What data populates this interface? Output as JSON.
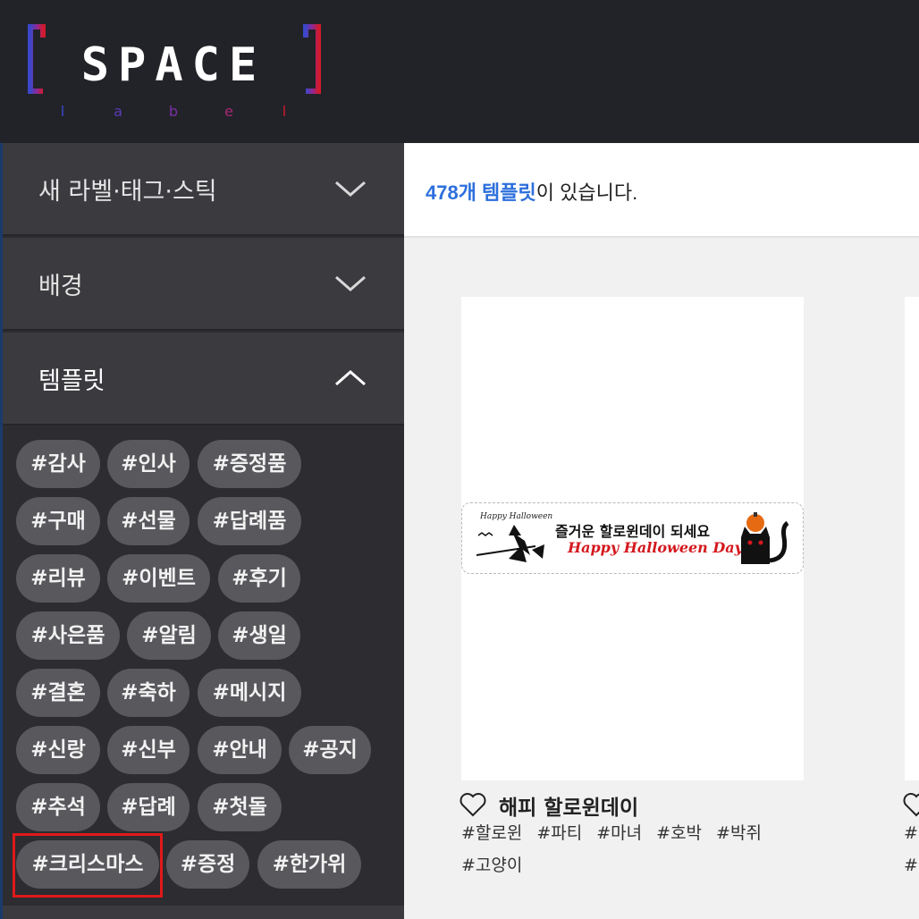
{
  "logo": {
    "main": "SPACE",
    "sub": [
      "l",
      "a",
      "b",
      "e",
      "l"
    ]
  },
  "sidebar": {
    "sections": [
      {
        "label": "새 라벨·태그·스틱",
        "state": "collapsed"
      },
      {
        "label": "배경",
        "state": "collapsed"
      },
      {
        "label": "템플릿",
        "state": "expanded"
      }
    ],
    "tags": [
      "#감사",
      "#인사",
      "#증정품",
      "#구매",
      "#선물",
      "#답례품",
      "#리뷰",
      "#이벤트",
      "#후기",
      "#사은품",
      "#알림",
      "#생일",
      "#결혼",
      "#축하",
      "#메시지",
      "#신랑",
      "#신부",
      "#안내",
      "#공지",
      "#추석",
      "#답례",
      "#첫돌",
      "#크리스마스",
      "#증정",
      "#한가위"
    ],
    "selected_tag": "#크리스마스"
  },
  "content": {
    "count_number": "478개 템플릿",
    "count_suffix": "이 있습니다."
  },
  "cards": [
    {
      "title": "해피 할로윈데이",
      "tags": [
        "#할로윈",
        "#파티",
        "#마녀",
        "#호박",
        "#박쥐",
        "#고양이"
      ],
      "label_text": "즐거운 할로윈데이 되세요",
      "label_sub": "Happy Halloween Day",
      "label_small": "Happy Halloween"
    },
    {
      "tags_partial": [
        "#할",
        "#박"
      ]
    }
  ],
  "colors": {
    "accent": "#2d6fdc",
    "highlight": "#e0191b",
    "sidebar": "#2c2c31"
  }
}
